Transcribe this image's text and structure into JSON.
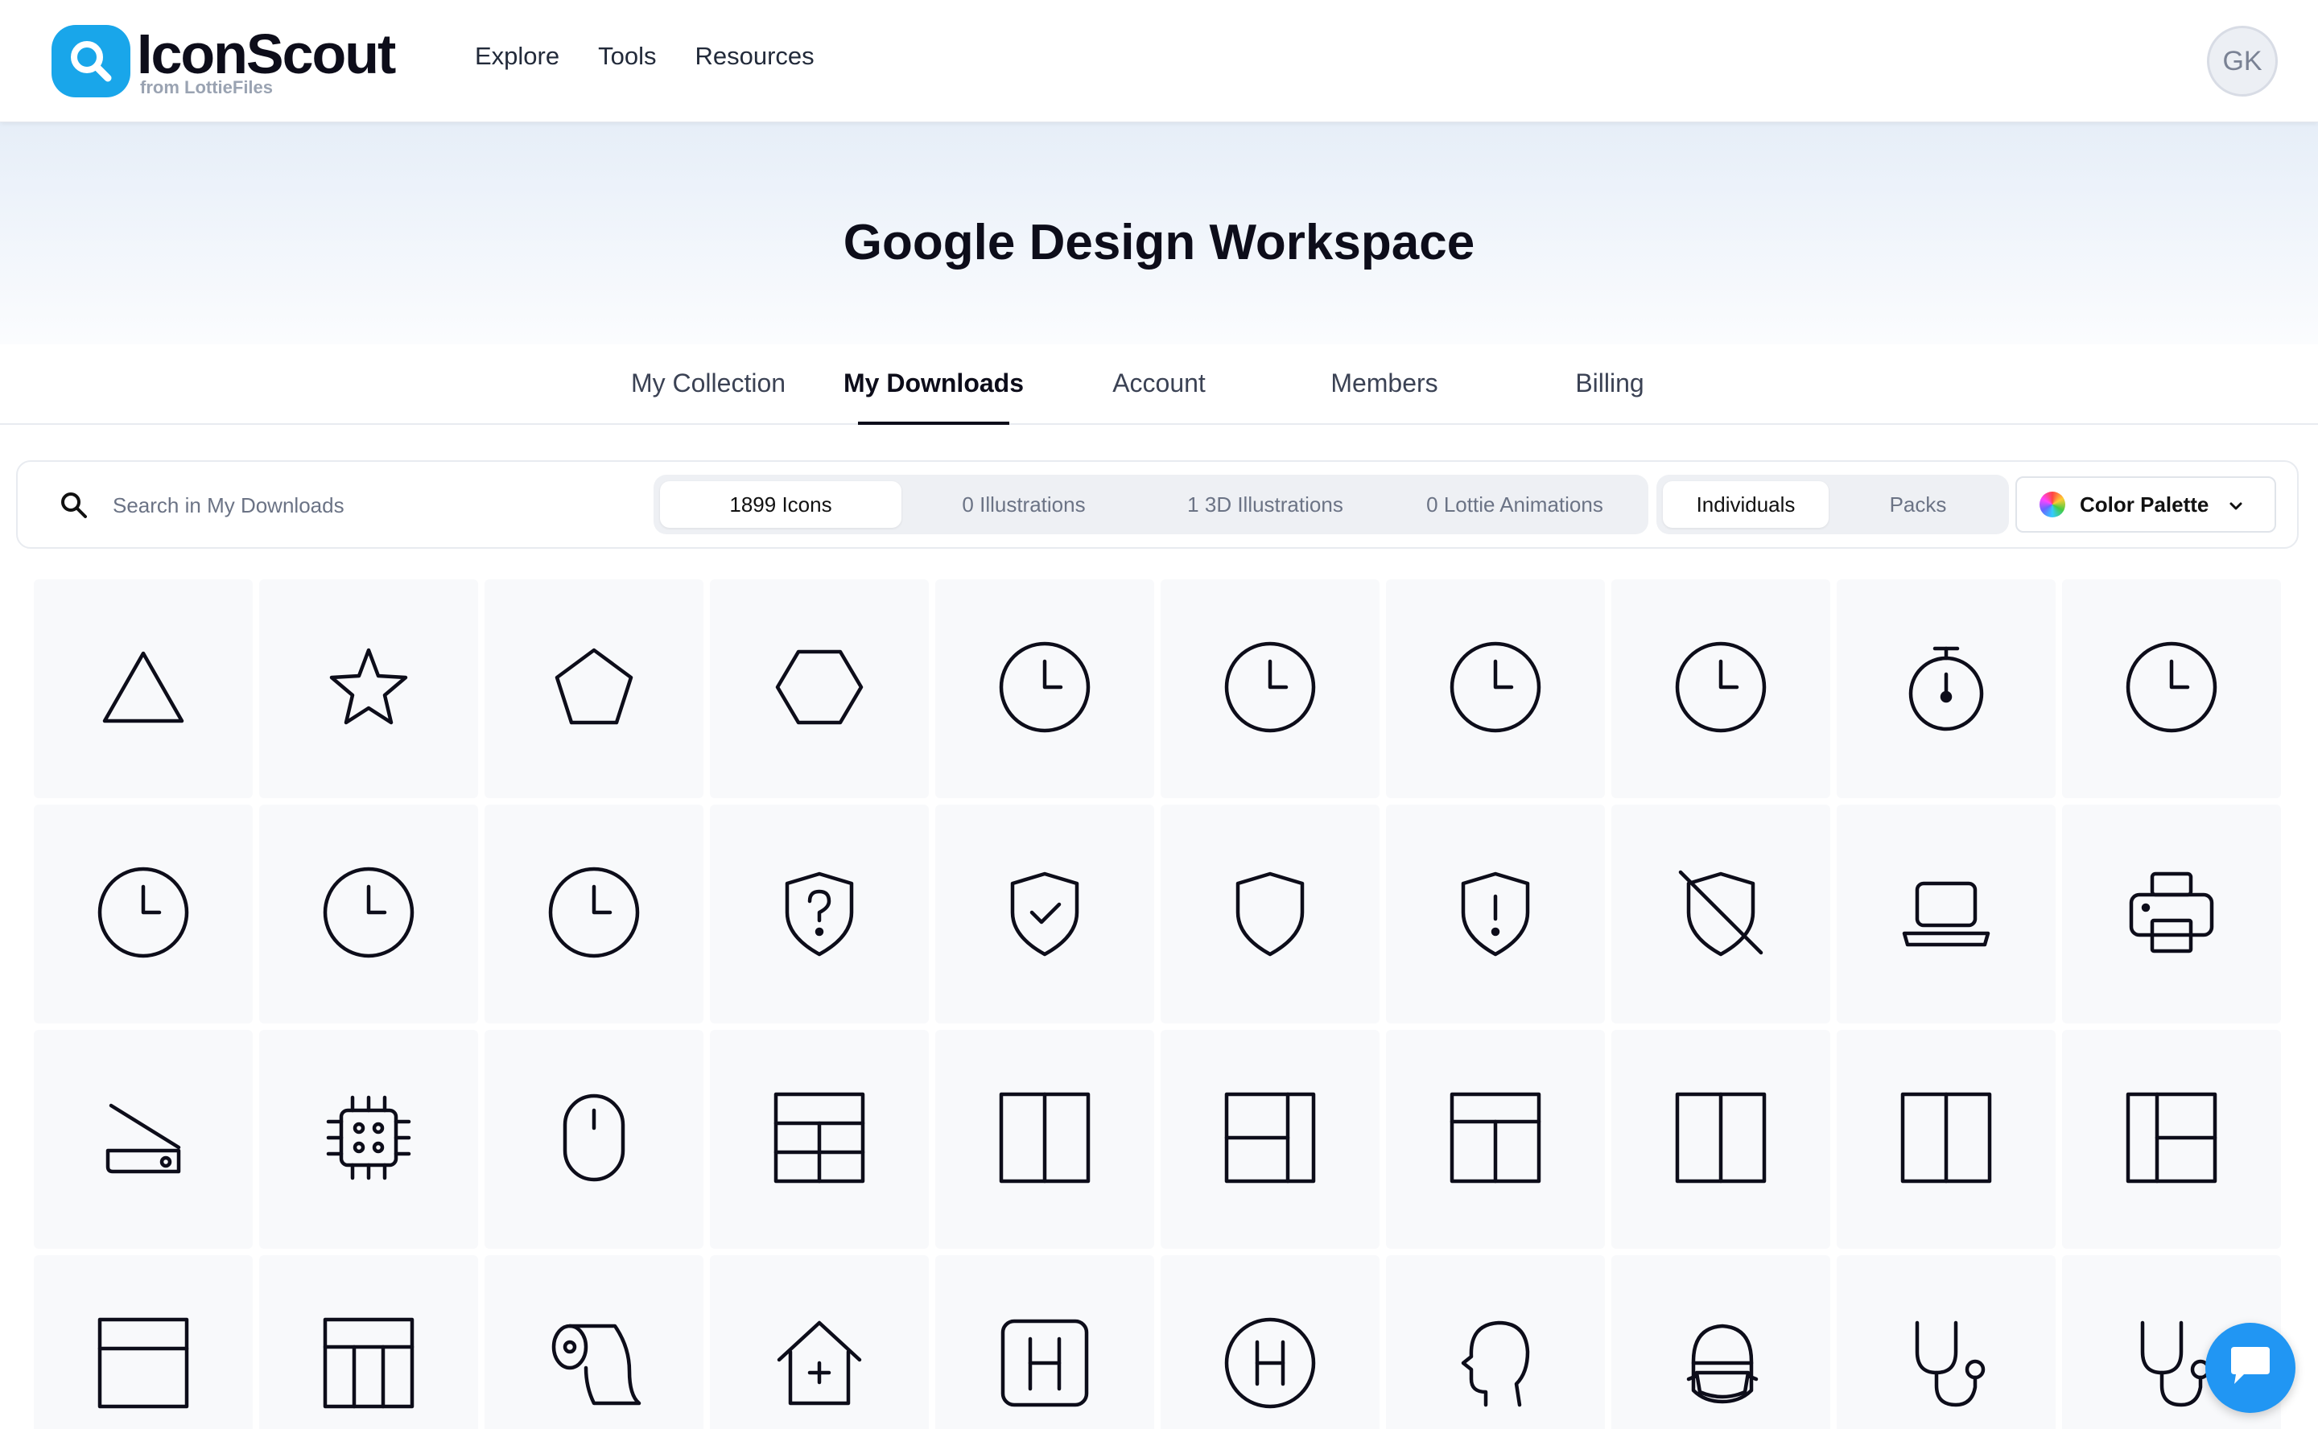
{
  "brand": {
    "name": "IconScout",
    "sub": "from LottieFiles",
    "color": "#19a6ea"
  },
  "nav": [
    "Explore",
    "Tools",
    "Resources"
  ],
  "user": {
    "initials": "GK"
  },
  "page_title": "Google Design Workspace",
  "tabs": [
    "My Collection",
    "My Downloads",
    "Account",
    "Members",
    "Billing"
  ],
  "active_tab": "My Downloads",
  "search": {
    "placeholder": "Search in My Downloads"
  },
  "asset_types": [
    "1899 Icons",
    "0 Illustrations",
    "1 3D Illustrations",
    "0 Lottie Animations"
  ],
  "asset_active": "1899 Icons",
  "view_mode": [
    "Individuals",
    "Packs"
  ],
  "view_active": "Individuals",
  "color_palette": {
    "label": "Color Palette"
  },
  "icons": [
    "triangle-icon",
    "star-icon",
    "pentagon-icon",
    "hexagon-icon",
    "clock-icon",
    "clock-icon",
    "clock-icon",
    "clock-icon",
    "stopwatch-icon",
    "clock-icon",
    "clock-icon",
    "clock-icon",
    "clock-icon",
    "shield-question-icon",
    "shield-check-icon",
    "shield-icon",
    "shield-alert-icon",
    "shield-off-icon",
    "laptop-icon",
    "printer-icon",
    "scanner-icon",
    "cpu-chip-icon",
    "mouse-icon",
    "table-layout-icon",
    "columns-layout-icon",
    "layout-split-icon",
    "layout-header-icon",
    "columns-layout-icon",
    "columns-layout-icon",
    "layout-sidebar-icon",
    "layout-top-icon",
    "table-columns-icon",
    "toilet-paper-icon",
    "home-medical-icon",
    "hospital-sign-icon",
    "hospital-circle-icon",
    "head-profile-icon",
    "head-mask-icon",
    "stethoscope-icon",
    "stethoscope-icon"
  ]
}
